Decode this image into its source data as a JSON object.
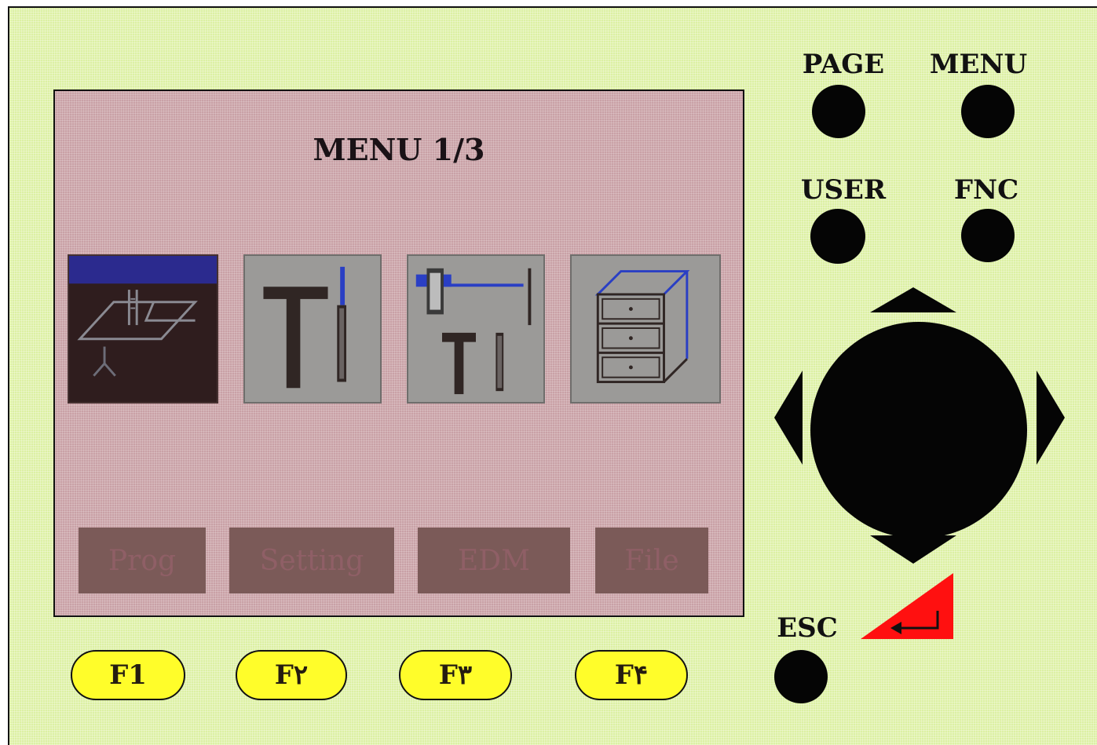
{
  "screen": {
    "title": "MENU 1/3",
    "items": [
      {
        "label": "Prog",
        "icon": "program-icon",
        "selected": true
      },
      {
        "label": "Setting",
        "icon": "tools-icon",
        "selected": false
      },
      {
        "label": "EDM",
        "icon": "edm-icon",
        "selected": false
      },
      {
        "label": "File",
        "icon": "file-cabinet-icon",
        "selected": false
      }
    ]
  },
  "function_keys": [
    "F1",
    "F۲",
    "F۳",
    "F۴"
  ],
  "buttons": {
    "page": "PAGE",
    "menu": "MENU",
    "user": "USER",
    "fnc": "FNC",
    "esc": "ESC"
  },
  "nav": {
    "up": "up-arrow-icon",
    "down": "down-arrow-icon",
    "left": "left-arrow-icon",
    "right": "right-arrow-icon",
    "enter": "enter-icon"
  },
  "colors": {
    "panel": "#dcf0a3",
    "screen": "#c9a1a6",
    "function_key": "#fffd2a",
    "enter_key": "#ff1010",
    "icon_blue": "#2a3fc4"
  }
}
